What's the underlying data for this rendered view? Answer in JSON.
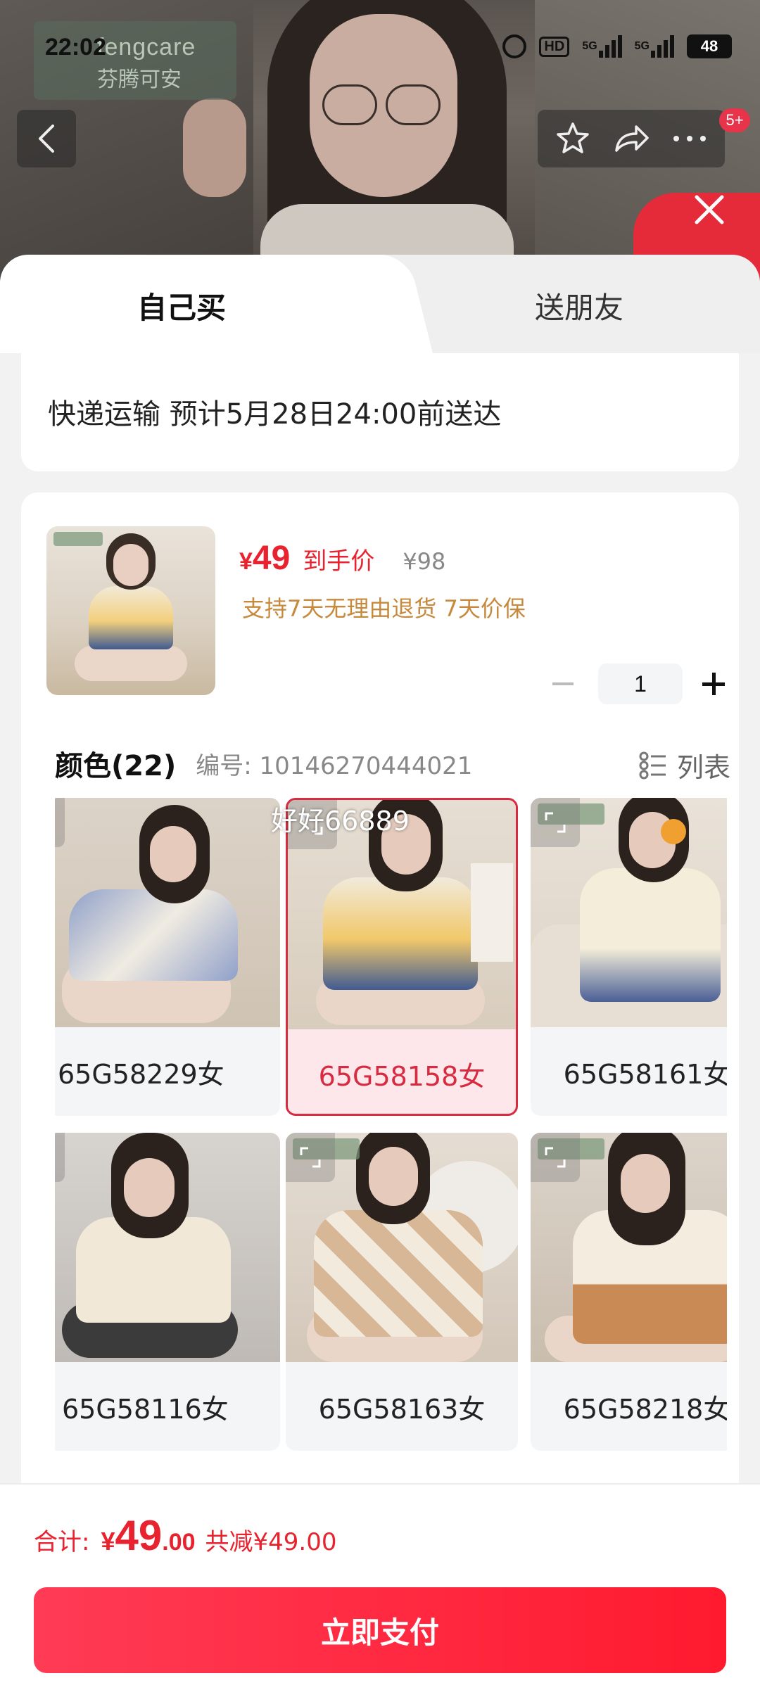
{
  "status_bar": {
    "time": "22:02",
    "hd": "HD",
    "net1": "5G",
    "net2": "5G",
    "battery": "48"
  },
  "header": {
    "brand_en": "fengcare",
    "brand_cn": "芬腾可安",
    "notification_badge": "5+",
    "icons": [
      "back-icon",
      "star-icon",
      "share-icon",
      "more-icon",
      "close-icon"
    ]
  },
  "tabs": [
    {
      "label": "自己买",
      "active": true
    },
    {
      "label": "送朋友",
      "active": false
    }
  ],
  "shipping": {
    "text": "快递运输 预计5月28日24:00前送达"
  },
  "product": {
    "price_symbol": "¥",
    "price": "49",
    "price_tag": "到手价",
    "original_price": "¥98",
    "guarantee": "支持7天无理由退货 7天价保",
    "quantity": "1"
  },
  "colors": {
    "title": "颜色(22)",
    "code": "编号: 10146270444021",
    "list_label": "列表",
    "overlay_text": "好好66889",
    "items": [
      {
        "label": "65G58229女",
        "selected": false
      },
      {
        "label": "65G58158女",
        "selected": true
      },
      {
        "label": "65G58161女",
        "selected": false
      },
      {
        "label": "65G58116女",
        "selected": false
      },
      {
        "label": "65G58163女",
        "selected": false
      },
      {
        "label": "65G58218女",
        "selected": false
      }
    ]
  },
  "footer": {
    "total_label": "合计:",
    "total_symbol": "¥",
    "total_int": "49",
    "total_dec": ".00",
    "discount": "共减¥49.00",
    "pay_button": "立即支付"
  },
  "colors_theme": {
    "accent": "#e8222f",
    "guarantee": "#c7893c",
    "selected_border": "#d72b42"
  }
}
